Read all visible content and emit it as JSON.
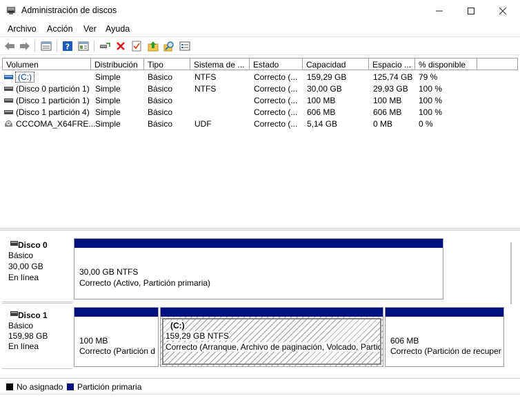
{
  "window": {
    "title": "Administración de discos"
  },
  "menu": [
    "Archivo",
    "Acción",
    "Ver",
    "Ayuda"
  ],
  "table": {
    "headers": [
      "Volumen",
      "Distribución",
      "Tipo",
      "Sistema de ...",
      "Estado",
      "Capacidad",
      "Espacio ...",
      "% disponible"
    ],
    "rows": [
      {
        "volume": "(C:)",
        "layout": "Simple",
        "type": "Básico",
        "fs": "NTFS",
        "status": "Correcto (...",
        "capacity": "159,29 GB",
        "free": "125,74 GB",
        "pct": "79 %"
      },
      {
        "volume": "(Disco 0 partición 1)",
        "layout": "Simple",
        "type": "Básico",
        "fs": "NTFS",
        "status": "Correcto (...",
        "capacity": "30,00 GB",
        "free": "29,93 GB",
        "pct": "100 %"
      },
      {
        "volume": "(Disco 1 partición 1)",
        "layout": "Simple",
        "type": "Básico",
        "fs": "",
        "status": "Correcto (...",
        "capacity": "100 MB",
        "free": "100 MB",
        "pct": "100 %"
      },
      {
        "volume": "(Disco 1 partición 4)",
        "layout": "Simple",
        "type": "Básico",
        "fs": "",
        "status": "Correcto (...",
        "capacity": "606 MB",
        "free": "606 MB",
        "pct": "100 %"
      },
      {
        "volume": "CCCOMA_X64FRE...",
        "layout": "Simple",
        "type": "Básico",
        "fs": "UDF",
        "status": "Correcto (...",
        "capacity": "5,14 GB",
        "free": "0 MB",
        "pct": "0 %"
      }
    ]
  },
  "disks": [
    {
      "name": "Disco 0",
      "type": "Básico",
      "size": "30,00 GB",
      "state": "En línea",
      "partitions": [
        {
          "title": "",
          "size": "30,00 GB NTFS",
          "status": "Correcto (Activo, Partición primaria)"
        }
      ]
    },
    {
      "name": "Disco 1",
      "type": "Básico",
      "size": "159,98 GB",
      "state": "En línea",
      "partitions": [
        {
          "title": "",
          "size": "100 MB",
          "status": "Correcto (Partición d"
        },
        {
          "title": "(C:)",
          "size": "159,29 GB NTFS",
          "status": "Correcto (Arranque, Archivo de paginación, Volcado, Partic"
        },
        {
          "title": "",
          "size": "606 MB",
          "status": "Correcto (Partición de recuper"
        }
      ]
    }
  ],
  "legend": [
    {
      "label": "No asignado",
      "color": "#000000"
    },
    {
      "label": "Partición primaria",
      "color": "#000f80"
    }
  ],
  "colors": {
    "primary_partition": "#000f80",
    "selection_text": "#0037a6"
  },
  "toolbar_icons": [
    "back-arrow-icon",
    "forward-arrow-icon",
    "list-view-icon",
    "help-icon",
    "properties-view-icon",
    "connect-disk-icon",
    "delete-icon",
    "check-icon",
    "up-folder-icon",
    "search-icon",
    "console-icon"
  ]
}
